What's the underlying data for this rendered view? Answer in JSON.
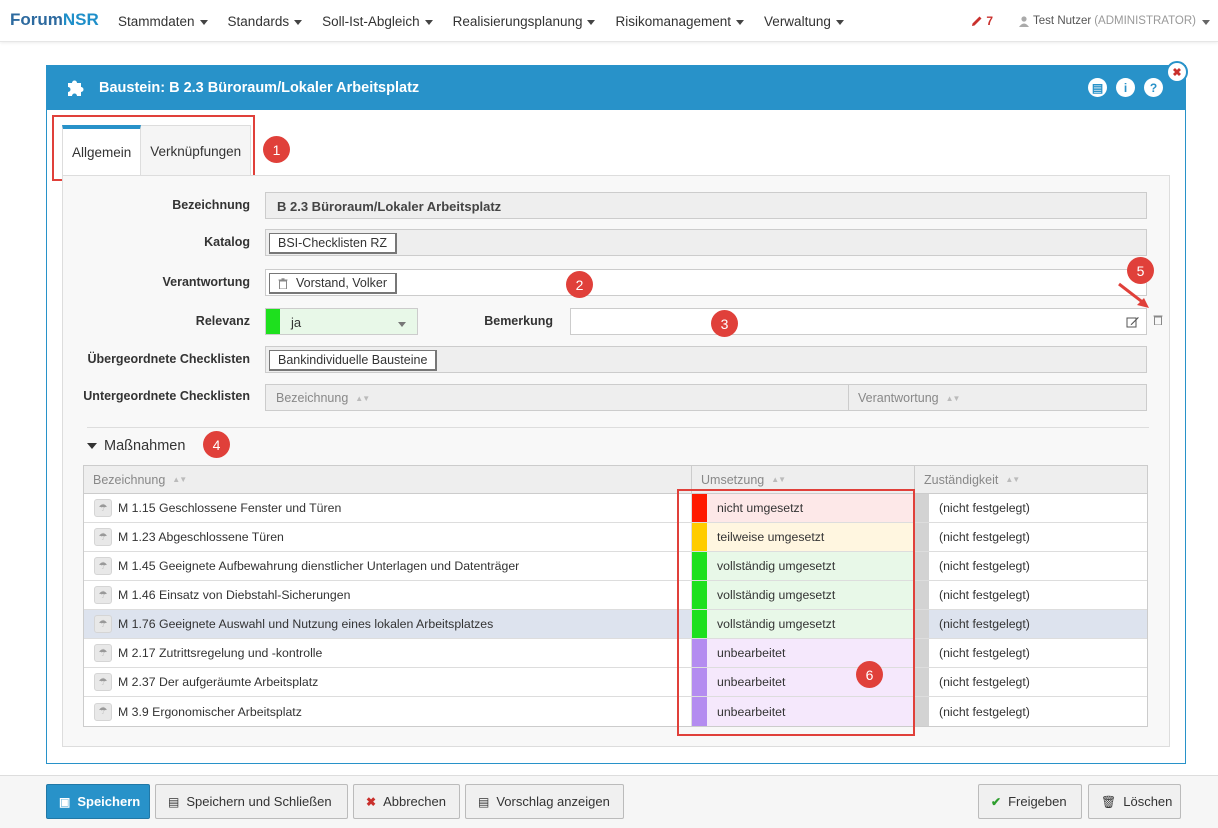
{
  "nav": {
    "brand_a": "Forum",
    "brand_b": "NSR",
    "menu": [
      {
        "label": "Stammdaten"
      },
      {
        "label": "Standards"
      },
      {
        "label": "Soll-Ist-Abgleich"
      },
      {
        "label": "Realisierungsplanung"
      },
      {
        "label": "Risikomanagement"
      },
      {
        "label": "Verwaltung"
      }
    ],
    "edit_count": "7",
    "user_name": "Test Nutzer",
    "user_role": "(ADMINISTRATOR)"
  },
  "panel": {
    "title": "Baustein: B 2.3 Büroraum/Lokaler Arbeitsplatz",
    "tabs": [
      {
        "label": "Allgemein"
      },
      {
        "label": "Verknüpfungen"
      }
    ]
  },
  "form": {
    "bezeichnung_label": "Bezeichnung",
    "bezeichnung_value": "B 2.3 Büroraum/Lokaler Arbeitsplatz",
    "katalog_label": "Katalog",
    "katalog_value": "BSI-Checklisten RZ",
    "verantwortung_label": "Verantwortung",
    "verantwortung_value": "Vorstand, Volker",
    "relevanz_label": "Relevanz",
    "relevanz_value": "ja",
    "bemerkung_label": "Bemerkung",
    "bemerkung_value": "",
    "uebergeordnete_label": "Übergeordnete Checklisten",
    "uebergeordnete_value": "Bankindividuelle Bausteine",
    "untergeordnete_label": "Untergeordnete Checklisten",
    "untergeordnete_col1": "Bezeichnung",
    "untergeordnete_col2": "Verantwortung"
  },
  "massnahmen": {
    "title": "Maßnahmen",
    "columns": [
      "Bezeichnung",
      "Umsetzung",
      "Zuständigkeit"
    ],
    "rows": [
      {
        "name": "M 1.15 Geschlossene Fenster und Türen",
        "status": "nicht umgesetzt",
        "color": "#ff1a00",
        "bg": "#fde8e8",
        "resp": "(nicht festgelegt)"
      },
      {
        "name": "M 1.23 Abgeschlossene Türen",
        "status": "teilweise umgesetzt",
        "color": "#ffcc00",
        "bg": "#fff6e0",
        "resp": "(nicht festgelegt)"
      },
      {
        "name": "M 1.45 Geeignete Aufbewahrung dienstlicher Unterlagen und Datenträger",
        "status": "vollständig umgesetzt",
        "color": "#1ee01e",
        "bg": "#e8f8e8",
        "resp": "(nicht festgelegt)"
      },
      {
        "name": "M 1.46 Einsatz von Diebstahl-Sicherungen",
        "status": "vollständig umgesetzt",
        "color": "#1ee01e",
        "bg": "#e8f8e8",
        "resp": "(nicht festgelegt)"
      },
      {
        "name": "M 1.76 Geeignete Auswahl und Nutzung eines lokalen Arbeitsplatzes",
        "status": "vollständig umgesetzt",
        "color": "#1ee01e",
        "bg": "#e8f8e8",
        "resp": "(nicht festgelegt)"
      },
      {
        "name": "M 2.17 Zutrittsregelung und -kontrolle",
        "status": "unbearbeitet",
        "color": "#b48cf0",
        "bg": "#f5e8fc",
        "resp": "(nicht festgelegt)"
      },
      {
        "name": "M 2.37 Der aufgeräumte Arbeitsplatz",
        "status": "unbearbeitet",
        "color": "#b48cf0",
        "bg": "#f5e8fc",
        "resp": "(nicht festgelegt)"
      },
      {
        "name": "M 3.9 Ergonomischer Arbeitsplatz",
        "status": "unbearbeitet",
        "color": "#b48cf0",
        "bg": "#f5e8fc",
        "resp": "(nicht festgelegt)"
      }
    ]
  },
  "annotations": [
    "1",
    "2",
    "3",
    "4",
    "5",
    "6"
  ],
  "footer": {
    "save": "Speichern",
    "save_close": "Speichern und Schließen",
    "cancel": "Abbrechen",
    "suggest": "Vorschlag anzeigen",
    "release": "Freigeben",
    "delete": "Löschen"
  },
  "colors": {
    "accent": "#2892c9",
    "annotation": "#e0403a"
  }
}
